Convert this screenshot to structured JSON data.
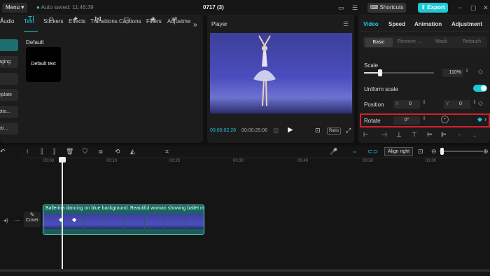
{
  "topbar": {
    "menu": "Menu",
    "saved": "Auto saved: 11:46:39",
    "project": "0717 (3)",
    "shortcuts": "Shortcuts",
    "export": "Export"
  },
  "tabs": [
    {
      "label": "Audio",
      "icon": "♪"
    },
    {
      "label": "Text",
      "icon": "TI"
    },
    {
      "label": "Stickers",
      "icon": "☺"
    },
    {
      "label": "Effects",
      "icon": "✦"
    },
    {
      "label": "Transitions",
      "icon": "⋈"
    },
    {
      "label": "Captions",
      "icon": "▭"
    },
    {
      "label": "Filters",
      "icon": "◈"
    },
    {
      "label": "Adjustme",
      "icon": "⇌"
    }
  ],
  "sidebar": [
    "t",
    "aging",
    "",
    "nplate",
    "ptio...",
    "pti..."
  ],
  "library": {
    "section": "Default",
    "card": "Default text"
  },
  "player": {
    "title": "Player",
    "time_current": "00:00:02:28",
    "time_total": "00:00:25:06",
    "ratio": "Ratio"
  },
  "inspector": {
    "tabs": [
      "Video",
      "Speed",
      "Animation",
      "Adjustment"
    ],
    "subtabs": [
      "Basic",
      "Remove ...",
      "Mask",
      "Retouch"
    ],
    "scale_label": "Scale",
    "scale_value": "110%",
    "uniform_label": "Uniform scale",
    "position_label": "Position",
    "pos_x_label": "X",
    "pos_x": "0",
    "pos_y_label": "Y",
    "pos_y": "0",
    "rotate_label": "Rotate",
    "rotate_value": "0°"
  },
  "timeline": {
    "ruler": [
      "00:00",
      "00:10",
      "00:20",
      "00:30",
      "00:40",
      "00:50",
      "01:00"
    ],
    "clip_title": "Ballerina dancing on blue background. Beautiful woman showing ballet m",
    "cover": "Cover",
    "tooltip": "Align right"
  },
  "colors": {
    "accent": "#1ec9d6",
    "highlight": "#d3202a"
  }
}
